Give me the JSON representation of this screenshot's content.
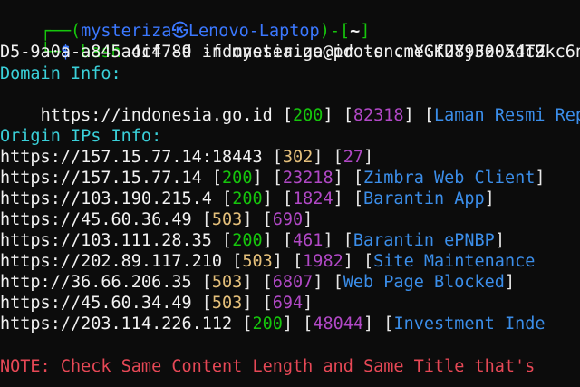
{
  "prompt": {
    "line1_left": "┌──(",
    "user": "mysteriza",
    "at": "㉿",
    "host": "Lenovo-Laptop",
    "mid": ")-[",
    "dir": "~",
    "end": "]",
    "line2_left": "└─",
    "dollar": "$",
    "cmd": "bash",
    "cmd_rest": " oif -d indonesia.go.id -s cmYGKUYjFz0XdTZkc6n",
    "cmd_wrap": "D5-9a0a-a845a4c4789 -f mysteriza@proton.me:f28930054c9"
  },
  "domain": {
    "header": "Domain Info:",
    "url": "https://indonesia.go.id",
    "status": "200",
    "length": "82318",
    "title": "Laman Resmi Rep"
  },
  "origin": {
    "header": "Origin IPs Info:",
    "rows": [
      {
        "url": "https://157.15.77.14:18443",
        "status": "302",
        "status_color": "gold",
        "length": "27",
        "title": ""
      },
      {
        "url": "https://157.15.77.14",
        "status": "200",
        "status_color": "green",
        "length": "23218",
        "title": "Zimbra Web Client"
      },
      {
        "url": "https://103.190.215.4",
        "status": "200",
        "status_color": "green",
        "length": "1824",
        "title": "Barantin App"
      },
      {
        "url": "https://45.60.36.49",
        "status": "503",
        "status_color": "gold",
        "length": "690",
        "title": ""
      },
      {
        "url": "https://103.111.28.35",
        "status": "200",
        "status_color": "green",
        "length": "461",
        "title": "Barantin ePNBP"
      },
      {
        "url": "https://202.89.117.210",
        "status": "503",
        "status_color": "gold",
        "length": "1982",
        "title": "Site Maintenance"
      },
      {
        "url": "http://36.66.206.35",
        "status": "503",
        "status_color": "gold",
        "length": "6807",
        "title": "Web Page Blocked"
      },
      {
        "url": "https://45.60.34.49",
        "status": "503",
        "status_color": "gold",
        "length": "694",
        "title": ""
      },
      {
        "url": "https://203.114.226.112",
        "status": "200",
        "status_color": "green",
        "length": "48044",
        "title": "Investment Inde"
      }
    ]
  },
  "note": "NOTE: Check Same Content Length and Same Title that's"
}
